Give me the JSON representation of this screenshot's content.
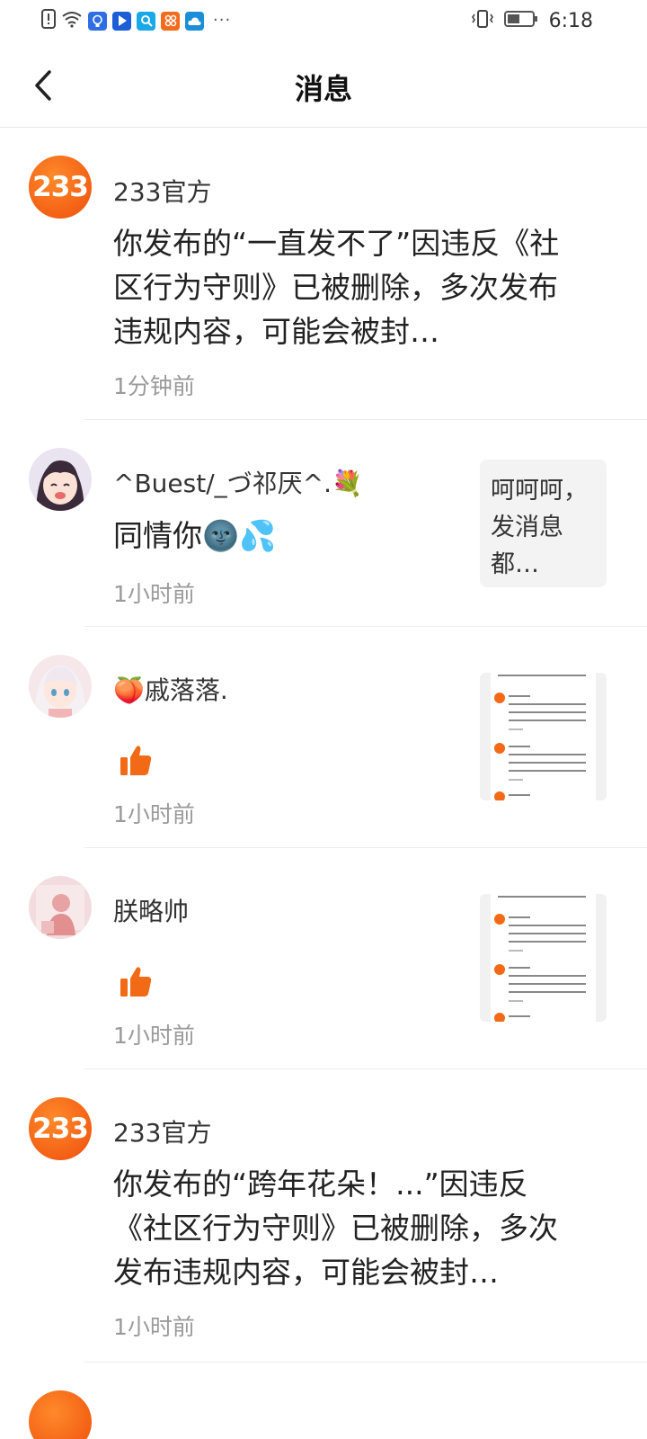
{
  "status_bar": {
    "time": "6:18",
    "app_icons": [
      "alert-icon",
      "wifi-icon",
      "bulb-app-icon",
      "play-app-icon",
      "search-app-icon",
      "grid-app-icon",
      "weather-app-icon"
    ],
    "overflow": "···"
  },
  "header": {
    "title": "消息"
  },
  "messages": [
    {
      "sender": "233官方",
      "text": "你发布的“一直发不了”因违反《社区行为守则》已被删除，多次发布违规内容，可能会被封…",
      "time": "1分钟前",
      "avatar": "233"
    },
    {
      "sender": "^Buest/_づ祁厌^.💐",
      "text": "同情你🌚💦",
      "time": "1小时前",
      "preview_text": "呵呵呵，发消息都…"
    },
    {
      "sender": "🍑戚落落.",
      "text": "",
      "time": "1小时前"
    },
    {
      "sender": "朕略帅",
      "text": "",
      "time": "1小时前"
    },
    {
      "sender": "233官方",
      "text": "你发布的“跨年花朵！...”因违反《社区行为守则》已被删除，多次发布违规内容，可能会被封…",
      "time": "1小时前",
      "avatar": "233"
    }
  ],
  "colors": {
    "accent": "#f26a16",
    "time_text": "#9a9a9a",
    "divider": "#ececec"
  }
}
